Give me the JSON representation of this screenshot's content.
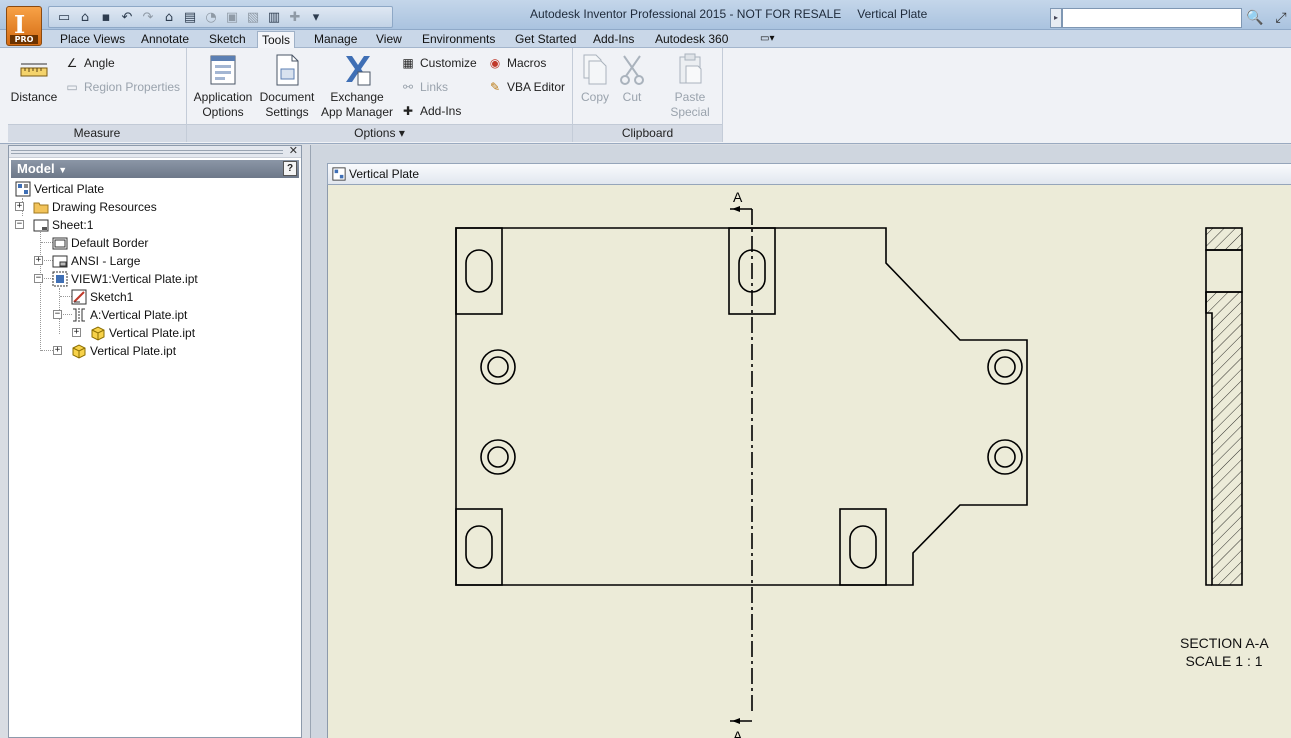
{
  "app": {
    "logo_letter": "I",
    "edition_badge": "PRO",
    "title": "Autodesk Inventor Professional 2015 - NOT FOR RESALE",
    "document": "Vertical Plate"
  },
  "tabs": [
    "Place Views",
    "Annotate",
    "Sketch",
    "Tools",
    "Manage",
    "View",
    "Environments",
    "Get Started",
    "Add-Ins",
    "Autodesk 360"
  ],
  "active_tab": "Tools",
  "ribbon": {
    "measure": {
      "label": "Measure",
      "distance": "Distance",
      "angle": "Angle",
      "region_properties": "Region Properties"
    },
    "options": {
      "label": "Options",
      "application_options": [
        "Application",
        "Options"
      ],
      "document_settings": [
        "Document",
        "Settings"
      ],
      "exchange_app_manager": [
        "Exchange",
        "App Manager"
      ],
      "customize": "Customize",
      "links": "Links",
      "add_ins": "Add-Ins",
      "macros": "Macros",
      "vba_editor": "VBA Editor"
    },
    "clipboard": {
      "label": "Clipboard",
      "copy": "Copy",
      "cut": "Cut",
      "paste_special": [
        "Paste",
        "Special"
      ]
    }
  },
  "browser": {
    "title": "Model",
    "help": "?",
    "tree": [
      {
        "label": "Vertical Plate",
        "icon": "drawing-icon"
      },
      {
        "label": "Drawing Resources",
        "icon": "folder-icon"
      },
      {
        "label": "Sheet:1",
        "icon": "sheet-icon"
      },
      {
        "label": "Default Border",
        "icon": "border-icon"
      },
      {
        "label": "ANSI - Large",
        "icon": "title-block-icon"
      },
      {
        "label": "VIEW1:Vertical Plate.ipt",
        "icon": "view-icon"
      },
      {
        "label": "Sketch1",
        "icon": "sketch-icon"
      },
      {
        "label": "A:Vertical Plate.ipt",
        "icon": "section-view-icon"
      },
      {
        "label": "Vertical Plate.ipt",
        "icon": "part-icon"
      },
      {
        "label": "Vertical Plate.ipt",
        "icon": "part-icon"
      }
    ]
  },
  "graphics": {
    "doc_tab": "Vertical Plate",
    "section_marker_top": "A",
    "section_marker_bottom": "A",
    "section_title": "SECTION A-A",
    "section_scale": "SCALE 1 : 1"
  },
  "colors": {
    "sheet_background": "#ecebd8",
    "app_orange": "#e2801f",
    "line": "#000000"
  }
}
